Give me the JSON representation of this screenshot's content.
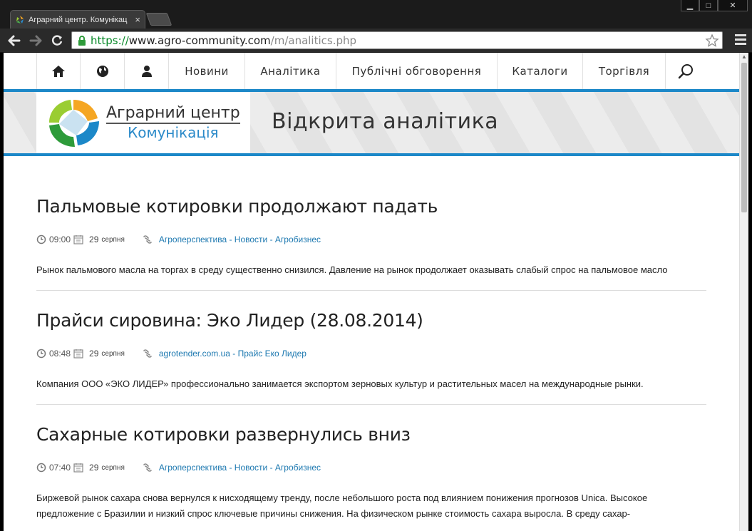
{
  "browser": {
    "tab_title": "Аграрний центр. Комунікац",
    "url_scheme": "https://",
    "url_host": "www.agro-community.com",
    "url_path": "/m/analitics.php"
  },
  "site_nav": {
    "items": [
      {
        "label": "Новини"
      },
      {
        "label": "Аналітика"
      },
      {
        "label": "Публічні обговорення"
      },
      {
        "label": "Каталоги"
      },
      {
        "label": "Торгівля"
      }
    ]
  },
  "banner": {
    "logo_line1": "Аграрний центр",
    "logo_line2": "Комунікація",
    "title": "Відкрита аналітика"
  },
  "articles": [
    {
      "title": "Пальмовые котировки продолжают падать",
      "time": "09:00",
      "date_day": "29",
      "date_month": "серпня",
      "source": "Агроперспектива - Новости - Агробизнес",
      "summary": "Рынок пальмового масла на торгах в среду существенно снизился. Давление на рынок продолжает оказывать слабый спрос на пальмовое масло"
    },
    {
      "title": "Прайси сировина: Эко Лидер (28.08.2014)",
      "time": "08:48",
      "date_day": "29",
      "date_month": "серпня",
      "source": "agrotender.com.ua - Прайс Еко Лидер",
      "summary": "Компания ООО «ЭКО ЛИДЕР» профессионально занимается экспортом зерновых культур и растительных масел на международные рынки."
    },
    {
      "title": "Сахарные котировки развернулись вниз",
      "time": "07:40",
      "date_day": "29",
      "date_month": "серпня",
      "source": "Агроперспектива - Новости - Агробизнес",
      "summary": "Биржевой рынок сахара снова вернулся к нисходящему тренду, после небольшого роста под влиянием понижения прогнозов Unica. Высокое предложение с Бразилии и низкий спрос ключевые причины снижения. На физическом рынке стоимость сахара выросла. В среду сахар-"
    }
  ],
  "colors": {
    "accent_blue": "#1c88c8",
    "link_blue": "#1c78b0",
    "secure_green": "#0a8a2a"
  }
}
